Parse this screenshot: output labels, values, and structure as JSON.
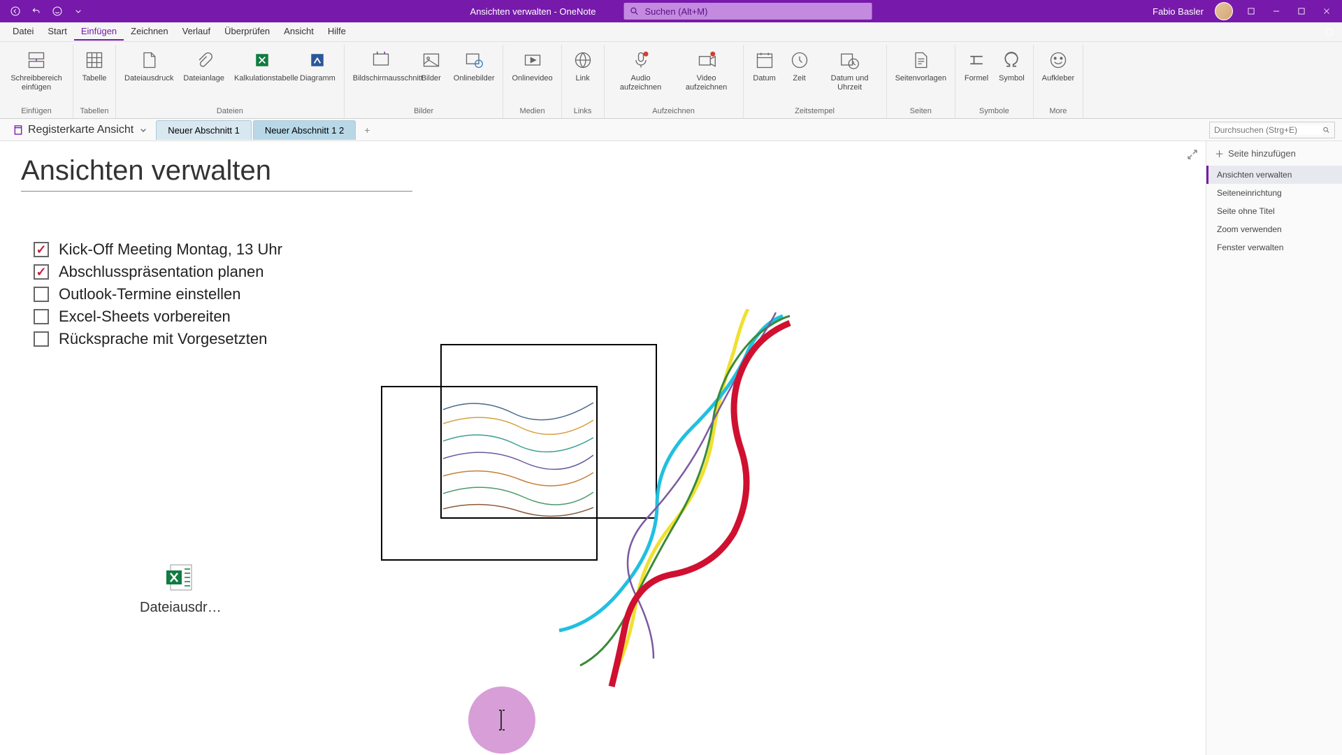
{
  "titlebar": {
    "title": "Ansichten verwalten - OneNote",
    "search_placeholder": "Suchen (Alt+M)",
    "user": "Fabio Basler"
  },
  "menu": {
    "items": [
      "Datei",
      "Start",
      "Einfügen",
      "Zeichnen",
      "Verlauf",
      "Überprüfen",
      "Ansicht",
      "Hilfe"
    ],
    "active_index": 2
  },
  "ribbon": {
    "groups": [
      {
        "label": "Einfügen",
        "buttons": [
          {
            "label": "Schreibbereich einfügen",
            "icon": "insert-space"
          }
        ]
      },
      {
        "label": "Tabellen",
        "buttons": [
          {
            "label": "Tabelle",
            "icon": "table"
          }
        ]
      },
      {
        "label": "Dateien",
        "buttons": [
          {
            "label": "Dateiausdruck",
            "icon": "file-printout"
          },
          {
            "label": "Dateianlage",
            "icon": "attachment"
          },
          {
            "label": "Kalkulationstabelle",
            "icon": "spreadsheet"
          },
          {
            "label": "Diagramm",
            "icon": "diagram"
          }
        ]
      },
      {
        "label": "Bilder",
        "buttons": [
          {
            "label": "Bildschirmausschnitt",
            "icon": "screenshot"
          },
          {
            "label": "Bilder",
            "icon": "pictures"
          },
          {
            "label": "Onlinebilder",
            "icon": "online-pictures"
          }
        ]
      },
      {
        "label": "Medien",
        "buttons": [
          {
            "label": "Onlinevideo",
            "icon": "video"
          }
        ]
      },
      {
        "label": "Links",
        "buttons": [
          {
            "label": "Link",
            "icon": "link"
          }
        ]
      },
      {
        "label": "Aufzeichnen",
        "buttons": [
          {
            "label": "Audio aufzeichnen",
            "icon": "audio"
          },
          {
            "label": "Video aufzeichnen",
            "icon": "video-rec"
          }
        ]
      },
      {
        "label": "Zeitstempel",
        "buttons": [
          {
            "label": "Datum",
            "icon": "date"
          },
          {
            "label": "Zeit",
            "icon": "time"
          },
          {
            "label": "Datum und Uhrzeit",
            "icon": "datetime"
          }
        ]
      },
      {
        "label": "Seiten",
        "buttons": [
          {
            "label": "Seitenvorlagen",
            "icon": "templates"
          }
        ]
      },
      {
        "label": "Symbole",
        "buttons": [
          {
            "label": "Formel",
            "icon": "equation"
          },
          {
            "label": "Symbol",
            "icon": "symbol"
          }
        ]
      },
      {
        "label": "More",
        "buttons": [
          {
            "label": "Aufkleber",
            "icon": "sticker"
          }
        ]
      }
    ]
  },
  "sections": {
    "notebook_label": "Registerkarte Ansicht",
    "tabs": [
      "Neuer Abschnitt 1",
      "Neuer Abschnitt 1 2"
    ],
    "active_index": 1,
    "page_search_placeholder": "Durchsuchen (Strg+E)"
  },
  "page": {
    "title": "Ansichten verwalten",
    "checklist": [
      {
        "text": "Kick-Off Meeting Montag, 13 Uhr",
        "checked": true
      },
      {
        "text": "Abschlusspräsentation planen",
        "checked": true
      },
      {
        "text": "Outlook-Termine einstellen",
        "checked": false
      },
      {
        "text": "Excel-Sheets vorbereiten",
        "checked": false
      },
      {
        "text": "Rücksprache mit Vorgesetzten",
        "checked": false
      }
    ],
    "attachment_label": "Dateiausdr…"
  },
  "page_panel": {
    "add_label": "Seite hinzufügen",
    "pages": [
      "Ansichten verwalten",
      "Seiteneinrichtung",
      "Seite ohne Titel",
      "Zoom verwenden",
      "Fenster verwalten"
    ],
    "active_index": 0
  }
}
